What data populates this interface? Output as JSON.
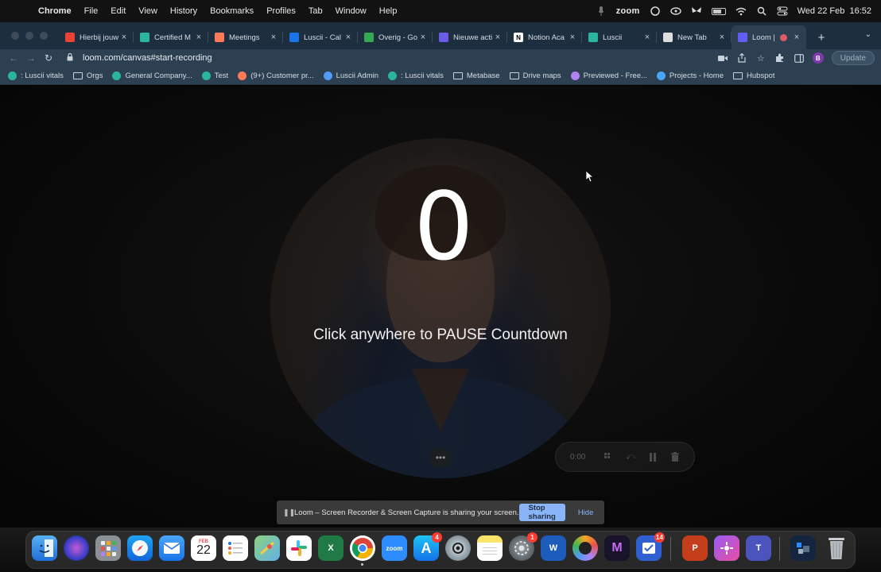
{
  "menubar": {
    "app_name": "Chrome",
    "items": [
      "File",
      "Edit",
      "View",
      "History",
      "Bookmarks",
      "Profiles",
      "Tab",
      "Window",
      "Help"
    ],
    "zoom_label": "zoom",
    "datetime": "Wed 22 Feb  16:52"
  },
  "tabs": [
    {
      "title": "Hierbij jouw",
      "favicon": "gmail",
      "color": "#ea4335"
    },
    {
      "title": "Certified M",
      "favicon": "luscii",
      "color": "#2bb5a0"
    },
    {
      "title": "Meetings",
      "favicon": "hubspot",
      "color": "#ff7a59"
    },
    {
      "title": "Luscii - Cal",
      "favicon": "calendar",
      "color": "#1a73e8"
    },
    {
      "title": "Overig - Go",
      "favicon": "drive",
      "color": "#34a853"
    },
    {
      "title": "Nieuwe acti",
      "favicon": "linear",
      "color": "#6b5ce7"
    },
    {
      "title": "Notion Aca",
      "favicon": "notion",
      "color": "#ffffff"
    },
    {
      "title": "Luscii",
      "favicon": "luscii",
      "color": "#2bb5a0"
    },
    {
      "title": "New Tab",
      "favicon": "chrome",
      "color": "#dddddd"
    },
    {
      "title": "Loom |",
      "favicon": "loom",
      "color": "#625df5",
      "active": true,
      "recording": true
    }
  ],
  "toolbar": {
    "url": "loom.com/canvas#start-recording",
    "update_label": "Update",
    "profile_initial": "B"
  },
  "bookmarks": [
    {
      "label": ": Luscii vitals",
      "icon": "luscii"
    },
    {
      "label": "Orgs",
      "icon": "folder"
    },
    {
      "label": "General Company...",
      "icon": "leaf"
    },
    {
      "label": "Test",
      "icon": "luscii"
    },
    {
      "label": "(9+) Customer pr...",
      "icon": "hubspot"
    },
    {
      "label": "Luscii Admin",
      "icon": "shield"
    },
    {
      "label": ": Luscii vitals",
      "icon": "luscii"
    },
    {
      "label": "Metabase",
      "icon": "folder"
    },
    {
      "label": "Drive maps",
      "icon": "folder"
    },
    {
      "label": "Previewed - Free...",
      "icon": "previewed"
    },
    {
      "label": "Projects - Home",
      "icon": "projects"
    },
    {
      "label": "Hubspot",
      "icon": "folder"
    }
  ],
  "recording": {
    "countdown": "0",
    "instruction": "Click anywhere to PAUSE Countdown",
    "elapsed": "0:00"
  },
  "sharing_bar": {
    "message": "Loom – Screen Recorder & Screen Capture is sharing your screen.",
    "stop_label": "Stop sharing",
    "hide_label": "Hide"
  },
  "dock": {
    "calendar_month": "FEB",
    "calendar_day": "22",
    "badges": {
      "app_store": "4",
      "teamwork": "14"
    },
    "apps": [
      "finder",
      "siri",
      "launchpad",
      "safari",
      "mail",
      "calendar",
      "reminders",
      "maps",
      "slack",
      "excel",
      "chrome",
      "zoom",
      "app-store",
      "camera",
      "notes",
      "system-settings",
      "word",
      "arc",
      "make",
      "tasks",
      "powerpoint",
      "loom",
      "teams",
      "downloads",
      "trash"
    ]
  }
}
